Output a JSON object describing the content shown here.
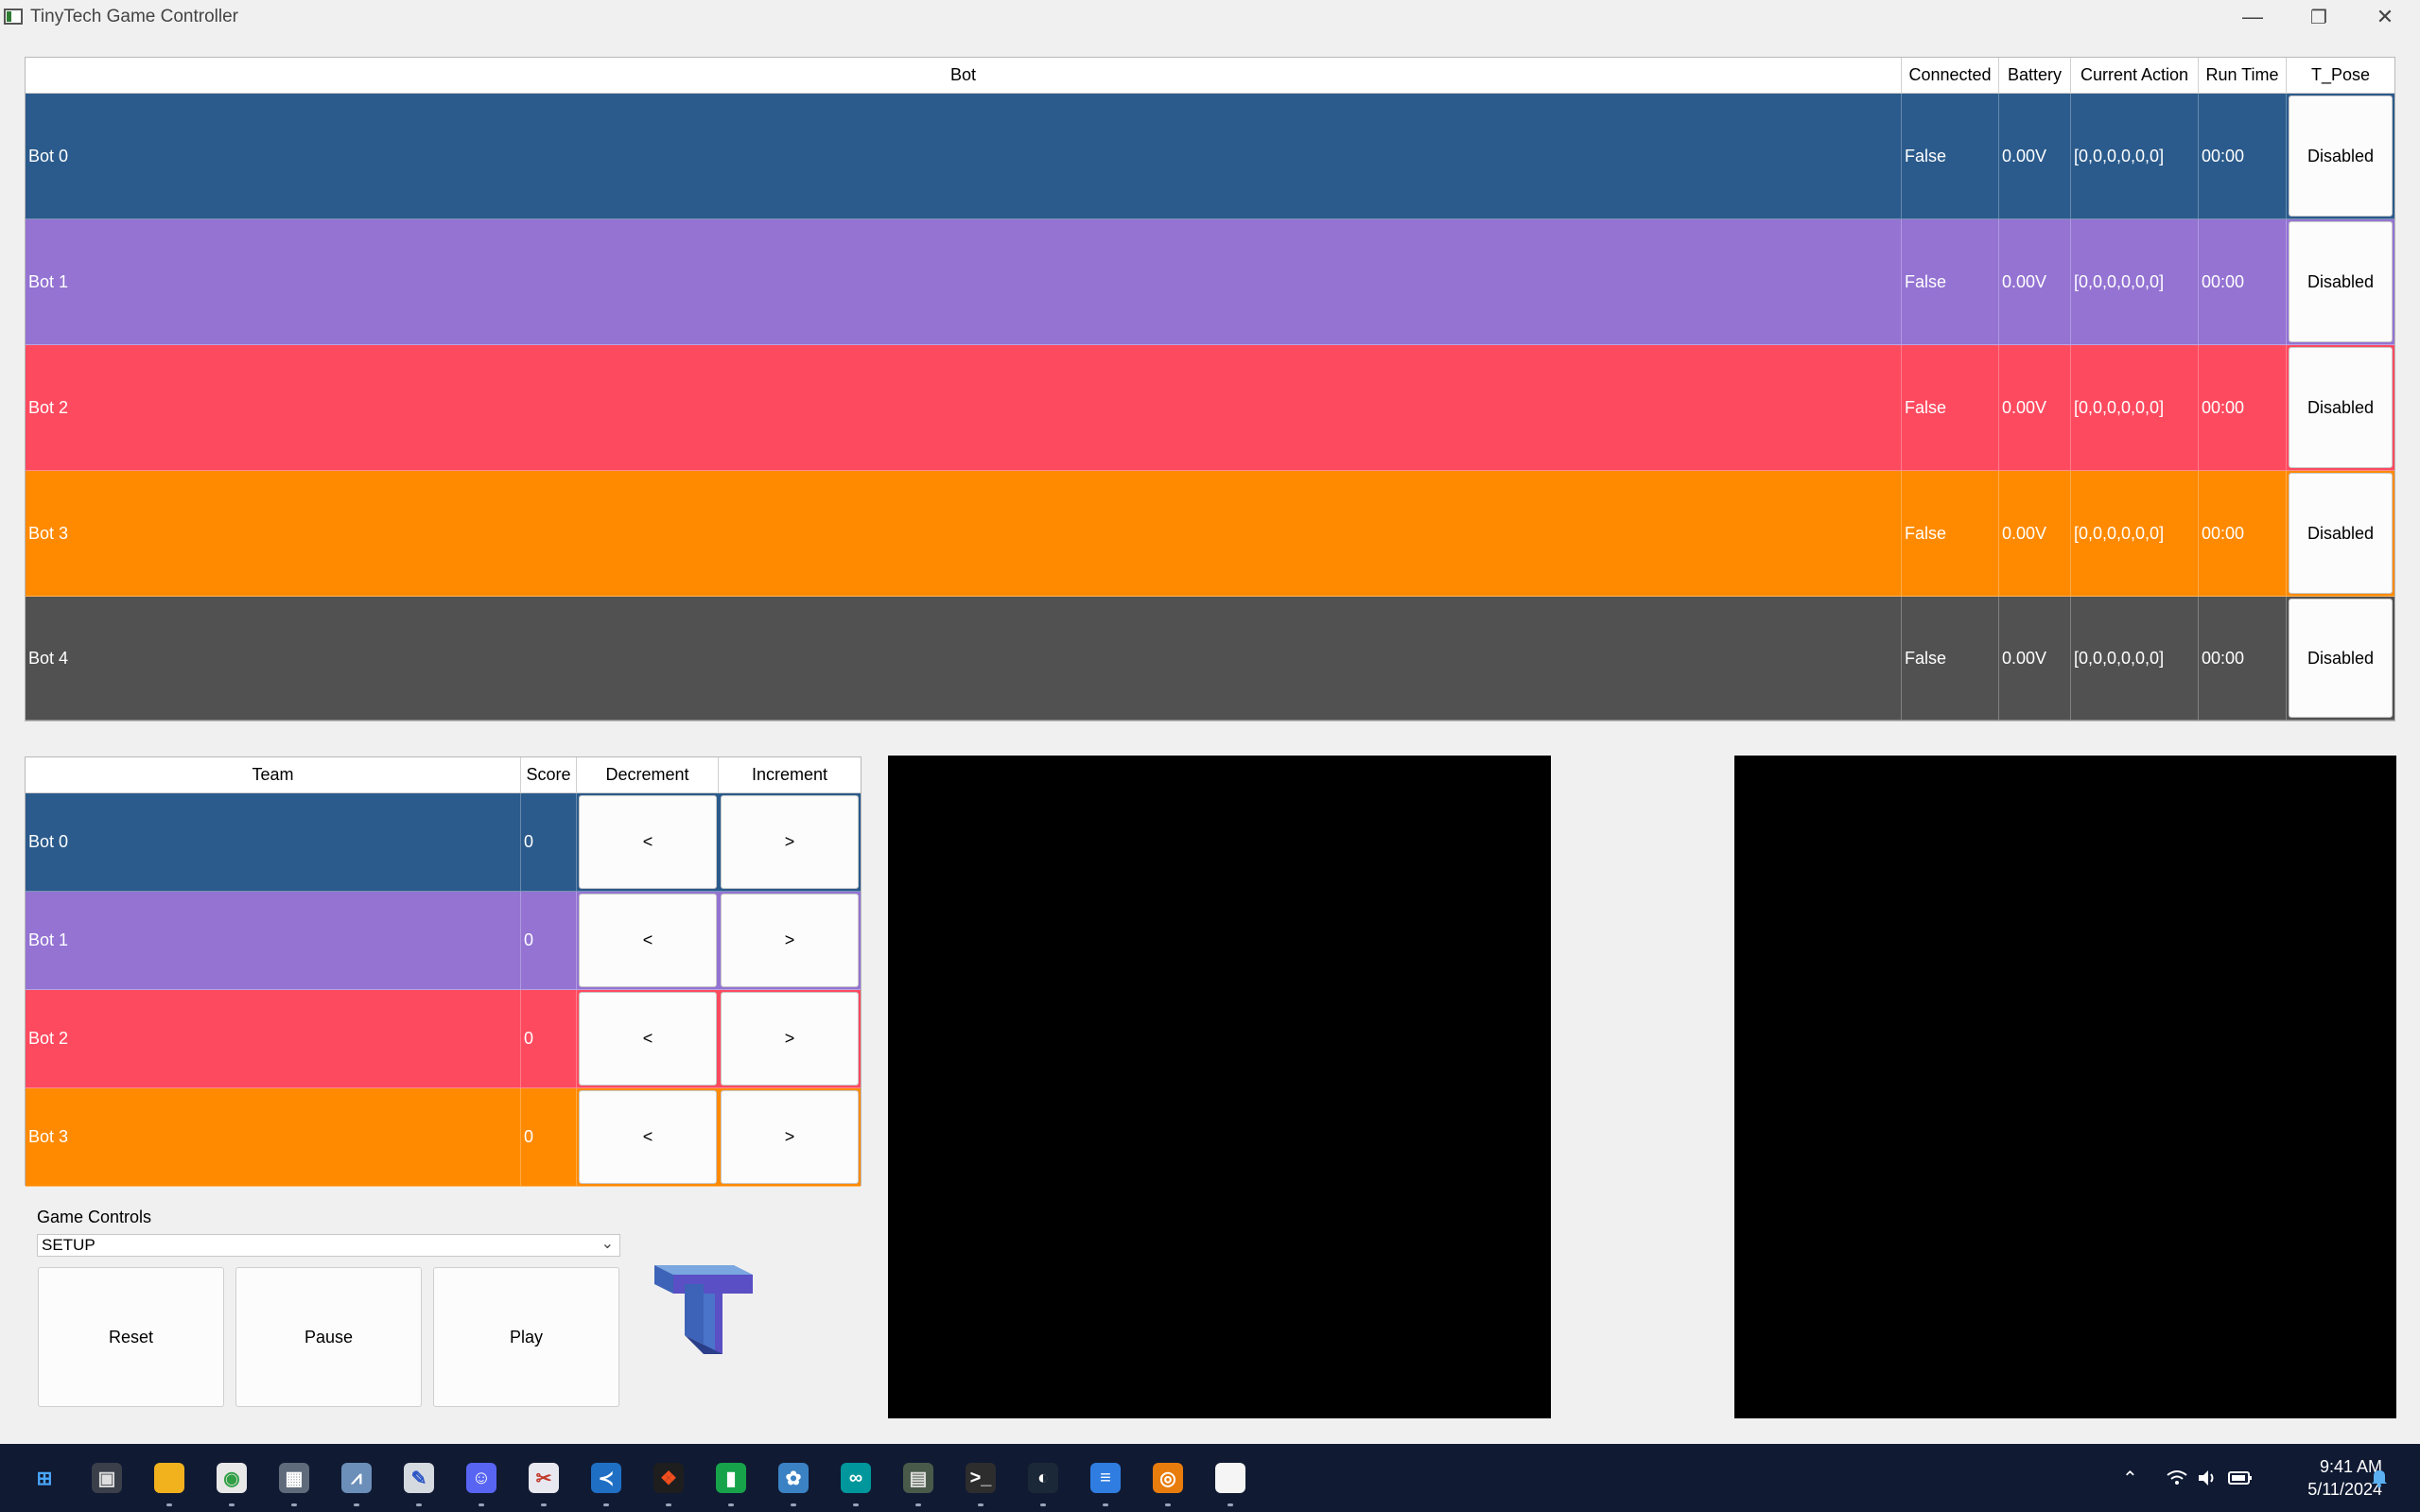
{
  "window": {
    "title": "TinyTech Game Controller",
    "minimize": "—",
    "restore": "❐",
    "close": "✕"
  },
  "bots_table": {
    "headers": [
      "Bot",
      "Connected",
      "Battery",
      "Current Action",
      "Run Time",
      "T_Pose"
    ],
    "rows": [
      {
        "name": "Bot 0",
        "connected": "False",
        "battery": "0.00V",
        "action": "[0,0,0,0,0,0]",
        "run_time": "00:00",
        "t_pose": "Disabled",
        "color": "#2b5b8c"
      },
      {
        "name": "Bot 1",
        "connected": "False",
        "battery": "0.00V",
        "action": "[0,0,0,0,0,0]",
        "run_time": "00:00",
        "t_pose": "Disabled",
        "color": "#9473d3"
      },
      {
        "name": "Bot 2",
        "connected": "False",
        "battery": "0.00V",
        "action": "[0,0,0,0,0,0]",
        "run_time": "00:00",
        "t_pose": "Disabled",
        "color": "#fe4a5f"
      },
      {
        "name": "Bot 3",
        "connected": "False",
        "battery": "0.00V",
        "action": "[0,0,0,0,0,0]",
        "run_time": "00:00",
        "t_pose": "Disabled",
        "color": "#ff8a00"
      },
      {
        "name": "Bot 4",
        "connected": "False",
        "battery": "0.00V",
        "action": "[0,0,0,0,0,0]",
        "run_time": "00:00",
        "t_pose": "Disabled",
        "color": "#515151"
      }
    ]
  },
  "score_table": {
    "headers": [
      "Team",
      "Score",
      "Decrement",
      "Increment"
    ],
    "rows": [
      {
        "team": "Bot 0",
        "score": "0",
        "dec": "<",
        "inc": ">",
        "color": "#2b5b8c"
      },
      {
        "team": "Bot 1",
        "score": "0",
        "dec": "<",
        "inc": ">",
        "color": "#9473d3"
      },
      {
        "team": "Bot 2",
        "score": "0",
        "dec": "<",
        "inc": ">",
        "color": "#fe4a5f"
      },
      {
        "team": "Bot 3",
        "score": "0",
        "dec": "<",
        "inc": ">",
        "color": "#ff8a00"
      }
    ]
  },
  "game_controls": {
    "label": "Game Controls",
    "state": "SETUP",
    "reset": "Reset",
    "pause": "Pause",
    "play": "Play"
  },
  "taskbar": {
    "time": "9:41 AM",
    "date": "5/11/2024",
    "apps": [
      "start-icon",
      "task-view-icon",
      "file-explorer-icon",
      "chrome-icon",
      "calculator-icon",
      "task-manager-icon",
      "paint-icon",
      "discord-icon",
      "snipping-tool-icon",
      "vscode-icon",
      "figma-icon",
      "sheets-icon",
      "davinci-icon",
      "arduino-icon",
      "circuit-icon",
      "terminal-icon",
      "steam-icon",
      "notepad-icon",
      "blender-icon",
      "file-icon"
    ]
  }
}
